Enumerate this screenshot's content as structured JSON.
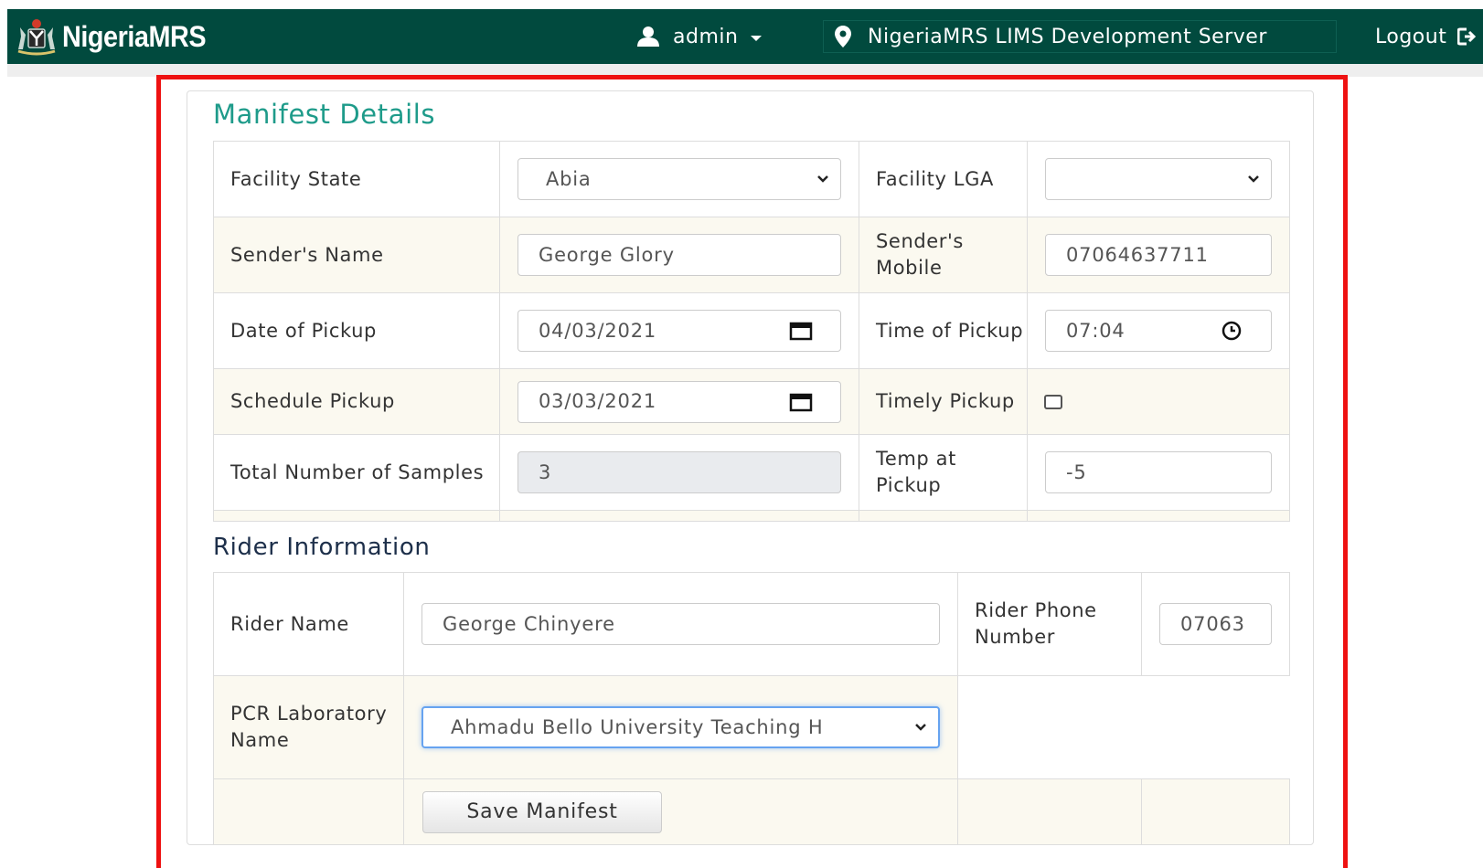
{
  "navbar": {
    "brand": "NigeriaMRS",
    "user": "admin",
    "server": "NigeriaMRS LIMS Development Server",
    "logout": "Logout",
    "bg_color": "#014a3e"
  },
  "manifest": {
    "title": "Manifest Details",
    "fields": {
      "facility_state": {
        "label": "Facility State",
        "value": "Abia"
      },
      "facility_lga": {
        "label": "Facility LGA",
        "value": ""
      },
      "sender_name": {
        "label": "Sender's Name",
        "value": "George Glory"
      },
      "sender_mobile": {
        "label": "Sender's Mobile",
        "value": "07064637711"
      },
      "date_of_pickup": {
        "label": "Date of Pickup",
        "value": "04/03/2021"
      },
      "time_of_pickup": {
        "label": "Time of Pickup",
        "value": "07:04"
      },
      "schedule_pickup": {
        "label": "Schedule Pickup",
        "value": "03/03/2021"
      },
      "timely_pickup": {
        "label": "Timely Pickup",
        "checked": false
      },
      "total_samples": {
        "label": "Total Number of Samples",
        "value": "3"
      },
      "temp_at_pickup": {
        "label": "Temp at Pickup",
        "value": "-5"
      }
    }
  },
  "rider": {
    "title": "Rider Information",
    "rider_name": {
      "label": "Rider Name",
      "value": "George Chinyere"
    },
    "rider_phone": {
      "label": "Rider Phone Number",
      "value": "07063"
    },
    "pcr_lab": {
      "label": "PCR Laboratory Name",
      "value": "Ahmadu Bello University Teaching H"
    },
    "save_label": "Save Manifest"
  },
  "colors": {
    "highlight": "#ee1111",
    "title_teal": "#1e9b8a",
    "row_alt": "#fbf9f0"
  }
}
